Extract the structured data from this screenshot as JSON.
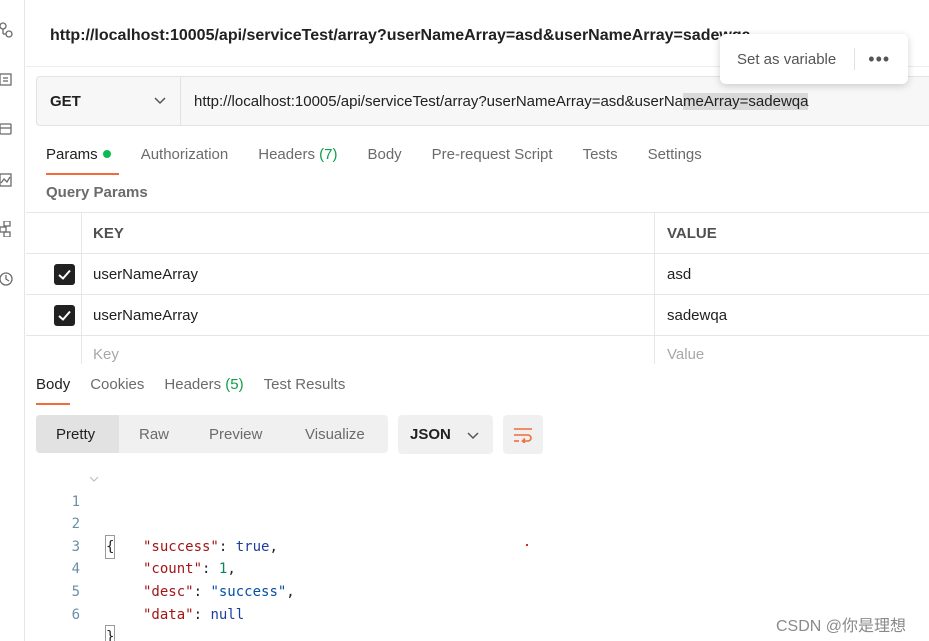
{
  "request_title": "http://localhost:10005/api/serviceTest/array?userNameArray=asd&userNameArray=sadewqa",
  "popover": {
    "label": "Set as variable",
    "more": "•••"
  },
  "request": {
    "method": "GET",
    "url_part1": "http://localhost:10005/api/serviceTest/array?userNameArray=asd&userNa",
    "url_selected": "meArray=sadewqa"
  },
  "request_tabs": [
    {
      "label": "Params"
    },
    {
      "label": "Authorization"
    },
    {
      "label": "Headers",
      "count": "(7)"
    },
    {
      "label": "Body"
    },
    {
      "label": "Pre-request Script"
    },
    {
      "label": "Tests"
    },
    {
      "label": "Settings"
    }
  ],
  "query_params": {
    "title": "Query Params",
    "headers": {
      "key": "KEY",
      "value": "VALUE"
    },
    "rows": [
      {
        "key": "userNameArray",
        "value": "asd",
        "checked": true
      },
      {
        "key": "userNameArray",
        "value": "sadewqa",
        "checked": true
      }
    ],
    "placeholder": {
      "key": "Key",
      "value": "Value"
    }
  },
  "response_tabs": [
    {
      "label": "Body"
    },
    {
      "label": "Cookies"
    },
    {
      "label": "Headers",
      "count": "(5)"
    },
    {
      "label": "Test Results"
    }
  ],
  "view_modes": [
    "Pretty",
    "Raw",
    "Preview",
    "Visualize"
  ],
  "format": "JSON",
  "code": {
    "line_numbers": [
      "1",
      "2",
      "3",
      "4",
      "5",
      "6"
    ],
    "open_brace": "{",
    "close_brace": "}",
    "fields": [
      {
        "key": "\"success\"",
        "value": "true",
        "sep": ","
      },
      {
        "key": "\"count\"",
        "value": "1",
        "sep": ","
      },
      {
        "key": "\"desc\"",
        "value": "\"success\"",
        "sep": ","
      },
      {
        "key": "\"data\"",
        "value": "null",
        "sep": ""
      }
    ]
  },
  "watermark": "CSDN @你是理想",
  "colors": {
    "accent": "#f26b3a",
    "green_dot": "#0cbb52",
    "green_count": "#0f9e4a"
  }
}
